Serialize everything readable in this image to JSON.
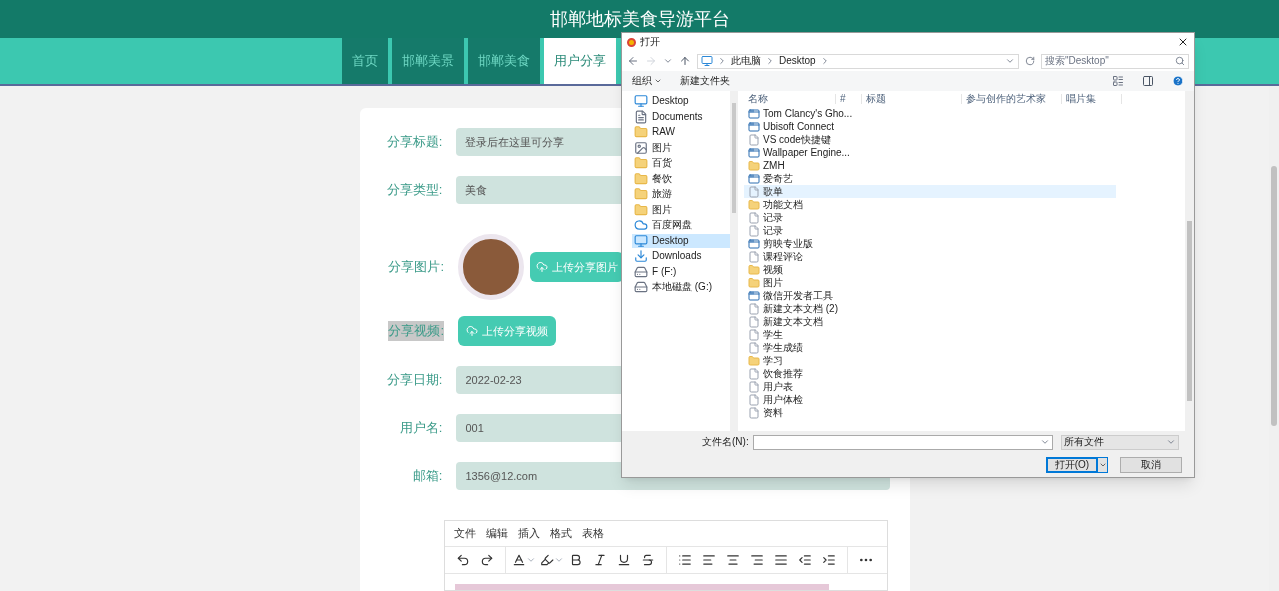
{
  "header": {
    "title": "邯郸地标美食导游平台"
  },
  "nav": [
    {
      "label": "首页",
      "selected": false
    },
    {
      "label": "邯郸美景",
      "selected": false
    },
    {
      "label": "邯郸美食",
      "selected": false
    },
    {
      "label": "用户分享",
      "selected": true
    }
  ],
  "form": {
    "fields": [
      {
        "kind": "text",
        "label": "分享标题:",
        "value": "登录后在这里可分享",
        "highlighted": false
      },
      {
        "kind": "text",
        "label": "分享类型:",
        "value": "美食",
        "highlighted": false
      },
      {
        "kind": "image",
        "label": "分享图片:",
        "button": "上传分享图片",
        "highlighted": false
      },
      {
        "kind": "upload",
        "label": "分享视频:",
        "button": "上传分享视频",
        "highlighted": true
      },
      {
        "kind": "text",
        "label": "分享日期:",
        "value": "2022-02-23",
        "highlighted": false
      },
      {
        "kind": "text",
        "label": "用户名:",
        "value": "001",
        "highlighted": false
      },
      {
        "kind": "text",
        "label": "邮箱:",
        "value": "1356@12.com",
        "highlighted": false
      }
    ]
  },
  "editor": {
    "menu": [
      "文件",
      "编辑",
      "插入",
      "格式",
      "表格"
    ]
  },
  "dialog": {
    "title": "打开",
    "path": [
      "此电脑",
      "Desktop"
    ],
    "search_placeholder": "搜索\"Desktop\"",
    "organize": "组织",
    "new_folder": "新建文件夹",
    "columns": [
      "名称",
      "#",
      "标题",
      "参与创作的艺术家",
      "唱片集"
    ],
    "nav_items": [
      {
        "label": "Desktop",
        "kind": "desktop",
        "selected": false
      },
      {
        "label": "Documents",
        "kind": "document",
        "selected": false
      },
      {
        "label": "RAW",
        "kind": "folder",
        "selected": false
      },
      {
        "label": "图片",
        "kind": "picture",
        "selected": false
      },
      {
        "label": "百货",
        "kind": "folder",
        "selected": false
      },
      {
        "label": "餐饮",
        "kind": "folder",
        "selected": false
      },
      {
        "label": "旅游",
        "kind": "folder",
        "selected": false
      },
      {
        "label": "图片",
        "kind": "folder",
        "selected": false
      },
      {
        "label": "百度网盘",
        "kind": "cloud",
        "selected": false
      },
      {
        "label": "Desktop",
        "kind": "desktop",
        "selected": true
      },
      {
        "label": "Downloads",
        "kind": "download",
        "selected": false
      },
      {
        "label": "F (F:)",
        "kind": "drive",
        "selected": false
      },
      {
        "label": "本地磁盘 (G:)",
        "kind": "drive",
        "selected": false
      }
    ],
    "files": [
      {
        "name": "Tom Clancy's Gho...",
        "kind": "app",
        "selected": false
      },
      {
        "name": "Ubisoft Connect",
        "kind": "app",
        "selected": false
      },
      {
        "name": "VS code快捷键",
        "kind": "file",
        "selected": false
      },
      {
        "name": "Wallpaper Engine...",
        "kind": "app",
        "selected": false
      },
      {
        "name": "ZMH",
        "kind": "folder",
        "selected": false
      },
      {
        "name": "爱奇艺",
        "kind": "app",
        "selected": false
      },
      {
        "name": "歌单",
        "kind": "file",
        "selected": true
      },
      {
        "name": "功能文档",
        "kind": "folder",
        "selected": false
      },
      {
        "name": "记录",
        "kind": "file",
        "selected": false
      },
      {
        "name": "记录",
        "kind": "file",
        "selected": false
      },
      {
        "name": "剪映专业版",
        "kind": "app",
        "selected": false
      },
      {
        "name": "课程评论",
        "kind": "file",
        "selected": false
      },
      {
        "name": "视频",
        "kind": "folder",
        "selected": false
      },
      {
        "name": "图片",
        "kind": "folder",
        "selected": false
      },
      {
        "name": "微信开发者工具",
        "kind": "app",
        "selected": false
      },
      {
        "name": "新建文本文档 (2)",
        "kind": "file",
        "selected": false
      },
      {
        "name": "新建文本文档",
        "kind": "file",
        "selected": false
      },
      {
        "name": "学生",
        "kind": "file",
        "selected": false
      },
      {
        "name": "学生成绩",
        "kind": "file",
        "selected": false
      },
      {
        "name": "学习",
        "kind": "folder",
        "selected": false
      },
      {
        "name": "饮食推荐",
        "kind": "file",
        "selected": false
      },
      {
        "name": "用户表",
        "kind": "file",
        "selected": false
      },
      {
        "name": "用户体检",
        "kind": "file",
        "selected": false
      },
      {
        "name": "资料",
        "kind": "file",
        "selected": false
      }
    ],
    "filename_label": "文件名(N):",
    "filter": "所有文件",
    "open_button": "打开(O)",
    "cancel_button": "取消"
  }
}
